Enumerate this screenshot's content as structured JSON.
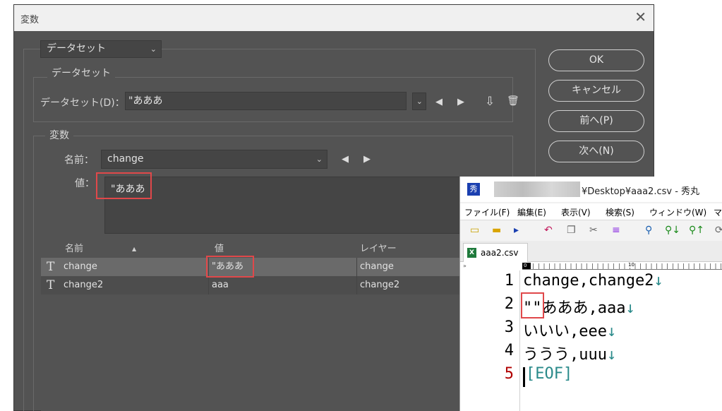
{
  "dialog": {
    "title": "変数",
    "close_glyph": "✕",
    "type_dropdown": {
      "value": "データセット"
    },
    "dataset_group": {
      "legend": "データセット",
      "label": "データセット(D)：",
      "value": "\"あああ",
      "prev_glyph": "◀",
      "next_glyph": "▶",
      "import_glyph": "⇩",
      "delete_glyph": "🗑"
    },
    "variables_group": {
      "legend": "変数",
      "name_label": "名前：",
      "name_value": "change",
      "prev_glyph": "◀",
      "next_glyph": "▶",
      "value_label": "値：",
      "value_text": "\"あああ"
    },
    "buttons": {
      "ok": "OK",
      "cancel": "キャンセル",
      "prev": "前へ(P)",
      "next": "次へ(N)"
    },
    "table": {
      "headers": {
        "name": "名前",
        "sort_glyph": "▲",
        "value": "値",
        "layer": "レイヤー"
      },
      "rows": [
        {
          "type_glyph": "T",
          "name": "change",
          "value": "\"あああ",
          "layer": "change"
        },
        {
          "type_glyph": "T",
          "name": "change2",
          "value": "aaa",
          "layer": "change2"
        }
      ]
    }
  },
  "hidemaru": {
    "app_icon_glyph": "秀",
    "title": "¥Desktop¥aaa2.csv - 秀丸",
    "menu": [
      "ファイル(F)",
      "編集(E)",
      "表示(V)",
      "検索(S)",
      "ウィンドウ(W)",
      "マ"
    ],
    "tab_label": "aaa2.csv",
    "tab_icon_glyph": "X",
    "ruler": {
      "start": "0",
      "tick10": "10"
    },
    "lines": [
      {
        "num": "1",
        "text": "change,change2",
        "nl": "↓"
      },
      {
        "num": "2",
        "text": "\"\"あああ,aaa",
        "nl": "↓"
      },
      {
        "num": "3",
        "text": "いいい,eee",
        "nl": "↓"
      },
      {
        "num": "4",
        "text": "ううう,uuu",
        "nl": "↓"
      },
      {
        "num": "5",
        "text": "[EOF]",
        "nl": ""
      }
    ],
    "colors": {
      "eof": "#2a8a8a",
      "last_line_number": "#b00000"
    }
  },
  "highlight_color": "#e0484a"
}
